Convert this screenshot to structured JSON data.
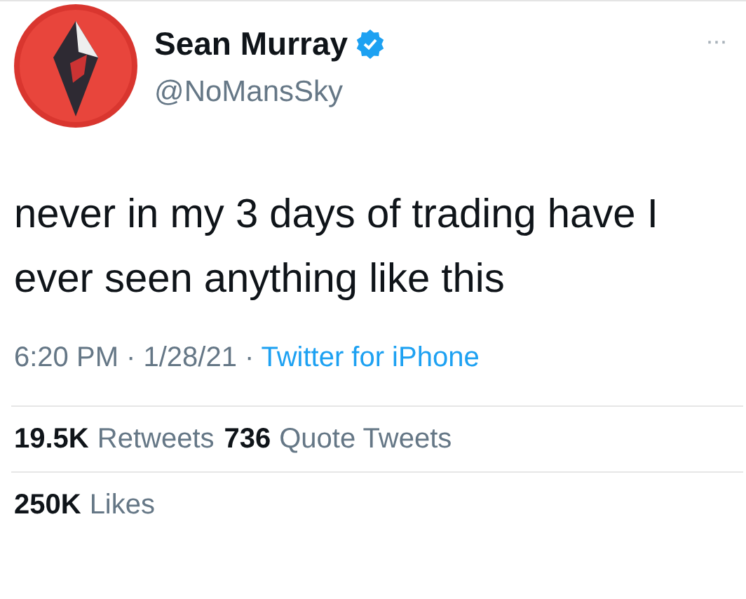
{
  "author": {
    "name": "Sean Murray",
    "verified": true,
    "handle": "@NoMansSky"
  },
  "menu": "···",
  "text": "never in my 3 days of trading have I ever seen anything like this",
  "timestamp": "6:20 PM · 1/28/21 ·",
  "source": "Twitter for iPhone",
  "stat_rows": [
    {
      "stats": [
        {
          "count": "19.5K",
          "label": "Retweets"
        },
        {
          "count": "736",
          "label": "Quote Tweets"
        }
      ]
    },
    {
      "stats": [
        {
          "count": "250K",
          "label": "Likes"
        }
      ]
    }
  ]
}
